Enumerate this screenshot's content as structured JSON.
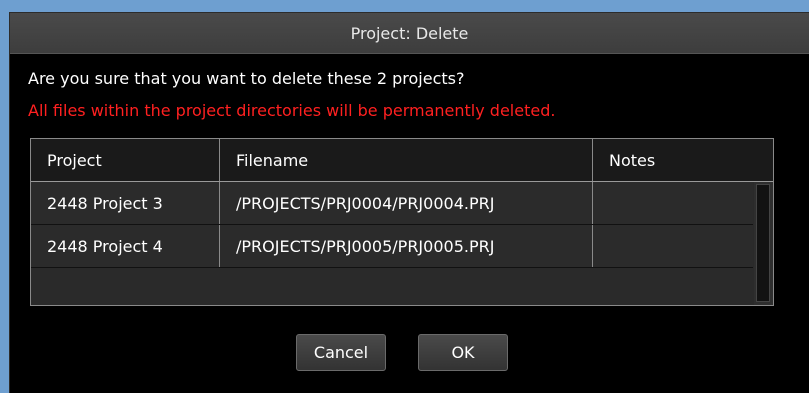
{
  "dialog": {
    "title": "Project: Delete",
    "question": "Are you sure that you want to delete these 2 projects?",
    "warning": "All files within the project directories will be permanently deleted.",
    "warning_color": "#ff2020"
  },
  "table": {
    "columns": [
      "Project",
      "Filename",
      "Notes"
    ],
    "rows": [
      {
        "project": "2448 Project 3",
        "filename": "/PROJECTS/PRJ0004/PRJ0004.PRJ",
        "notes": ""
      },
      {
        "project": "2448 Project 4",
        "filename": "/PROJECTS/PRJ0005/PRJ0005.PRJ",
        "notes": ""
      }
    ]
  },
  "buttons": {
    "cancel_label": "Cancel",
    "ok_label": "OK"
  }
}
